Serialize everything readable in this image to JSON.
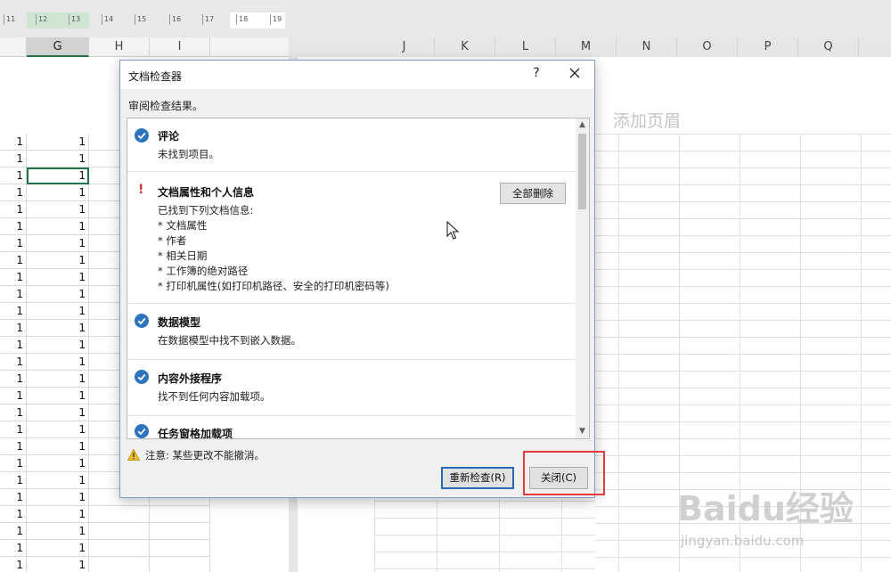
{
  "ruler": {
    "labels": [
      "11",
      "12",
      "13",
      "14",
      "15",
      "16",
      "17",
      "18",
      "19"
    ]
  },
  "columns": {
    "left": [
      "G",
      "H",
      "I"
    ],
    "right": [
      "J",
      "K",
      "L",
      "M",
      "N",
      "O",
      "P",
      "Q"
    ]
  },
  "sheet": {
    "cell_value": "1",
    "header_hint": "添加页眉"
  },
  "dialog": {
    "title": "文档检查器",
    "help": "?",
    "subtitle": "审阅检查结果。",
    "sections": [
      {
        "status": "ok",
        "title": "评论",
        "description": "未找到项目。"
      },
      {
        "status": "warning",
        "title": "文档属性和个人信息",
        "description": "已找到下列文档信息:",
        "items": [
          "* 文档属性",
          "* 作者",
          "* 相关日期",
          "* 工作簿的绝对路径",
          "* 打印机属性(如打印机路径、安全的打印机密码等)"
        ],
        "action": "全部删除"
      },
      {
        "status": "ok",
        "title": "数据模型",
        "description": "在数据模型中找不到嵌入数据。"
      },
      {
        "status": "ok",
        "title": "内容外接程序",
        "description": "找不到任何内容加载项。"
      },
      {
        "status": "ok",
        "title": "任务窗格加载项",
        "description": ""
      }
    ],
    "note": "注意: 某些更改不能撤消。",
    "buttons": {
      "reinspect": "重新检查(R)",
      "close": "关闭(C)"
    }
  },
  "watermark": {
    "brand": "Baidu经验",
    "site": "jingyan.baidu.com"
  },
  "colors": {
    "accent": "#217346",
    "check": "#2e73bd",
    "warning": "#d13438",
    "highlight": "#e23b3b"
  }
}
